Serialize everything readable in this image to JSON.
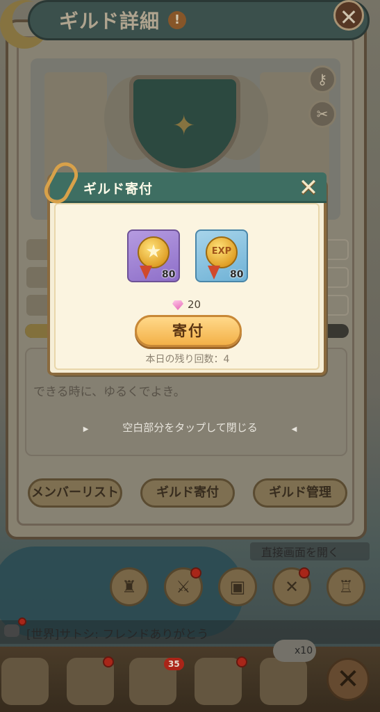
{
  "guild_panel": {
    "title": "ギルド詳細",
    "title_warning": "!",
    "close_glyph": "✕",
    "description": "できる時に、ゆるくでよき。",
    "tap_hint": "空白部分をタップして閉じる",
    "buttons": {
      "member_list": "メンバーリスト",
      "donate": "ギルド寄付",
      "manage": "ギルド管理"
    },
    "side_icons": [
      "key-icon",
      "tools-icon"
    ]
  },
  "donation_modal": {
    "title": "ギルド寄付",
    "close_glyph": "✕",
    "items": [
      {
        "icon": "star-medal-icon",
        "count": "80",
        "color": "#9d82d6"
      },
      {
        "icon": "exp-medal-icon",
        "count": "80",
        "color": "#8dc3e0"
      }
    ],
    "cost": "20",
    "donate_label": "寄付",
    "remaining": "本日の残り回数：4"
  },
  "bottom": {
    "direct_open": "直接画面を開く",
    "chat_message": "[世界]サトシ: フレンドありがとう",
    "multiplier": "x10",
    "nav_badge": "35",
    "nav_items": [
      "hero-avatar",
      "pet-fox",
      "guild-clock",
      "shop-house",
      "castle-map"
    ],
    "round_buttons": [
      "chess-icon",
      "swords-shield-icon",
      "chest-icon",
      "crossed-swords-icon",
      "castle-icon"
    ]
  },
  "colors": {
    "modal_header": "#3e6e62",
    "donate_button": "#f3b148",
    "red_badge": "#b4271a"
  }
}
